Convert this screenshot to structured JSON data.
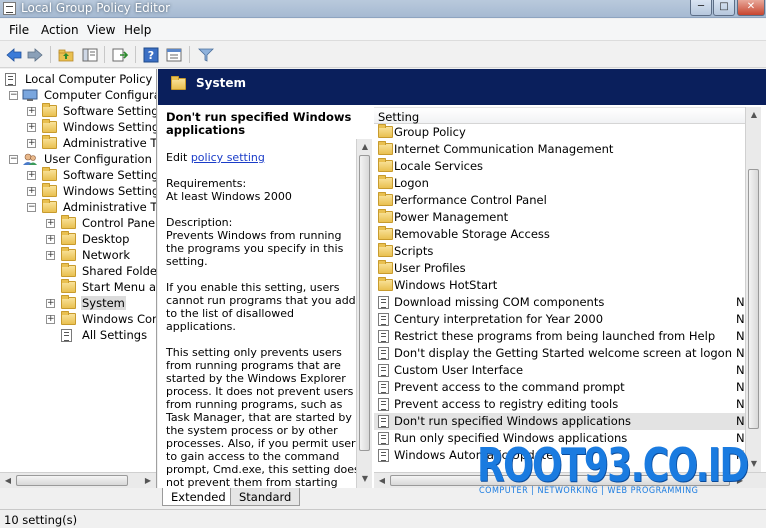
{
  "window": {
    "title": "Local Group Policy Editor",
    "buttons": {
      "minimize": "─",
      "maximize": "□",
      "close": "✕"
    }
  },
  "menu": [
    "File",
    "Action",
    "View",
    "Help"
  ],
  "toolbar": [
    "back-arrow-icon",
    "forward-arrow-icon",
    "up-folder-icon",
    "show-hide-tree-icon",
    "export-list-icon",
    "help-icon",
    "properties-icon",
    "filter-icon"
  ],
  "tree": {
    "root": "Local Computer Policy",
    "computer_configuration": "Computer Configuratio",
    "cc_software": "Software Settings",
    "cc_windows": "Windows Settings",
    "cc_admin": "Administrative Tem",
    "user_configuration": "User Configuration",
    "uc_software": "Software Settings",
    "uc_windows": "Windows Settings",
    "uc_admin": "Administrative Tem",
    "control_panel": "Control Panel",
    "desktop": "Desktop",
    "network": "Network",
    "shared_folders": "Shared Folders",
    "start_menu": "Start Menu and",
    "system": "System",
    "windows_comp": "Windows Comp",
    "all_settings": "All Settings"
  },
  "header": {
    "title": "System"
  },
  "description": {
    "title": "Don't run specified Windows applications",
    "edit_prefix": "Edit",
    "edit_link": "policy setting",
    "requirements_label": "Requirements:",
    "requirements_value": "At least Windows 2000",
    "description_label": "Description:",
    "para1": "Prevents Windows from running the programs you specify in this setting.",
    "para2": "If you enable this setting, users cannot run programs that you add to the list of disallowed applications.",
    "para3": "This setting only prevents users from running programs that are started by the Windows Explorer process. It does not prevent users from running programs, such as Task Manager, that are started by the system process or by other processes. Also, if you permit users to gain access to the command prompt, Cmd.exe, this setting does not prevent them from starting programs in the command window that they are not permitted to start by using Windows Explorer."
  },
  "list": {
    "column_setting": "Setting",
    "folders": [
      "Group Policy",
      "Internet Communication Management",
      "Locale Services",
      "Logon",
      "Performance Control Panel",
      "Power Management",
      "Removable Storage Access",
      "Scripts",
      "User Profiles",
      "Windows HotStart"
    ],
    "settings": [
      {
        "name": "Download missing COM components",
        "state": "N"
      },
      {
        "name": "Century interpretation for Year 2000",
        "state": "N"
      },
      {
        "name": "Restrict these programs from being launched from Help",
        "state": "N"
      },
      {
        "name": "Don't display the Getting Started welcome screen at logon",
        "state": "N"
      },
      {
        "name": "Custom User Interface",
        "state": "N"
      },
      {
        "name": "Prevent access to the command prompt",
        "state": "N"
      },
      {
        "name": "Prevent access to registry editing tools",
        "state": "N"
      },
      {
        "name": "Don't run specified Windows applications",
        "state": "N"
      },
      {
        "name": "Run only specified Windows applications",
        "state": "N"
      },
      {
        "name": "Windows Automatic Updates",
        "state": "N"
      }
    ]
  },
  "tabs": {
    "extended": "Extended",
    "standard": "Standard"
  },
  "status": {
    "text": "10 setting(s)"
  },
  "watermark": {
    "main": "ROOT93.CO.ID",
    "sub": "COMPUTER | NETWORKING | WEB PROGRAMMING"
  },
  "colors": {
    "header_bg": "#0a1f5c",
    "link": "#1a3cc8",
    "selection": "#e3e3e3",
    "watermark": "#1a7be0"
  }
}
